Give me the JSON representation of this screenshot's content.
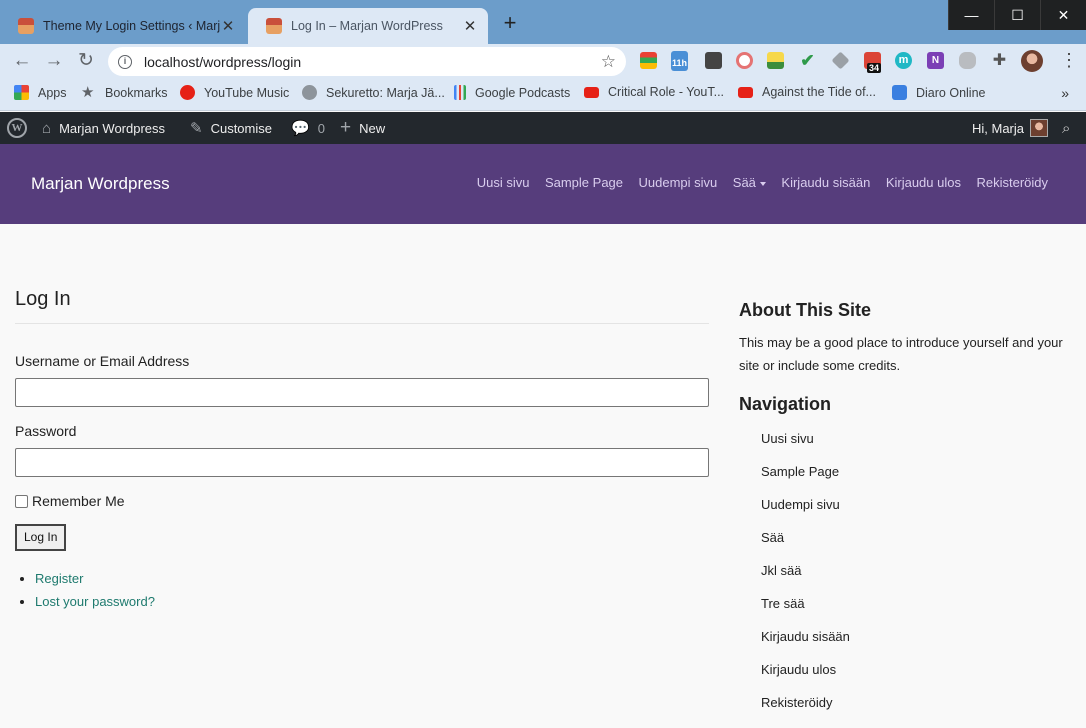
{
  "browser": {
    "tabs": [
      {
        "title": "Theme My Login Settings ‹ Marja",
        "active": false
      },
      {
        "title": "Log In – Marjan WordPress",
        "active": true
      }
    ],
    "url": "localhost/wordpress/login",
    "window_controls": {
      "minimize": "—",
      "maximize": "☐",
      "close": "✕"
    },
    "extension_badge": "34",
    "extension_calendar_label": "11h",
    "bookmarks": [
      {
        "label": "Apps",
        "icon": "apps-grid-icon"
      },
      {
        "label": "Bookmarks",
        "icon": "star-icon"
      },
      {
        "label": "YouTube Music",
        "icon": "youtube-music-icon"
      },
      {
        "label": "Sekuretto: Marja Jä...",
        "icon": "globe-icon"
      },
      {
        "label": "Google Podcasts",
        "icon": "google-podcasts-icon"
      },
      {
        "label": "Critical Role - YouT...",
        "icon": "youtube-icon"
      },
      {
        "label": "Against the Tide of...",
        "icon": "youtube-icon"
      },
      {
        "label": "Diaro Online",
        "icon": "diaro-icon"
      }
    ]
  },
  "adminbar": {
    "site_name": "Marjan Wordpress",
    "customise": "Customise",
    "comments_count": "0",
    "new": "New",
    "greeting": "Hi, Marja"
  },
  "site": {
    "title": "Marjan Wordpress",
    "nav": [
      "Uusi sivu",
      "Sample Page",
      "Uudempi sivu",
      "Sää",
      "Kirjaudu sisään",
      "Kirjaudu ulos",
      "Rekisteröidy"
    ]
  },
  "login": {
    "heading": "Log In",
    "username_label": "Username or Email Address",
    "username_value": "",
    "password_label": "Password",
    "password_value": "",
    "remember_label": "Remember Me",
    "submit_label": "Log In",
    "links": [
      "Register",
      "Lost your password?"
    ]
  },
  "sidebar": {
    "about_heading": "About This Site",
    "about_text": "This may be a good place to introduce yourself and your site or include some credits.",
    "nav_heading": "Navigation",
    "nav_items": [
      "Uusi sivu",
      "Sample Page",
      "Uudempi sivu",
      "Sää",
      "Jkl sää",
      "Tre sää",
      "Kirjaudu sisään",
      "Kirjaudu ulos",
      "Rekisteröidy"
    ]
  },
  "colors": {
    "header_purple": "#563d7c",
    "adminbar": "#23282d",
    "link_teal": "#1e7a6e",
    "chrome_tabstrip": "#6c9dca"
  }
}
